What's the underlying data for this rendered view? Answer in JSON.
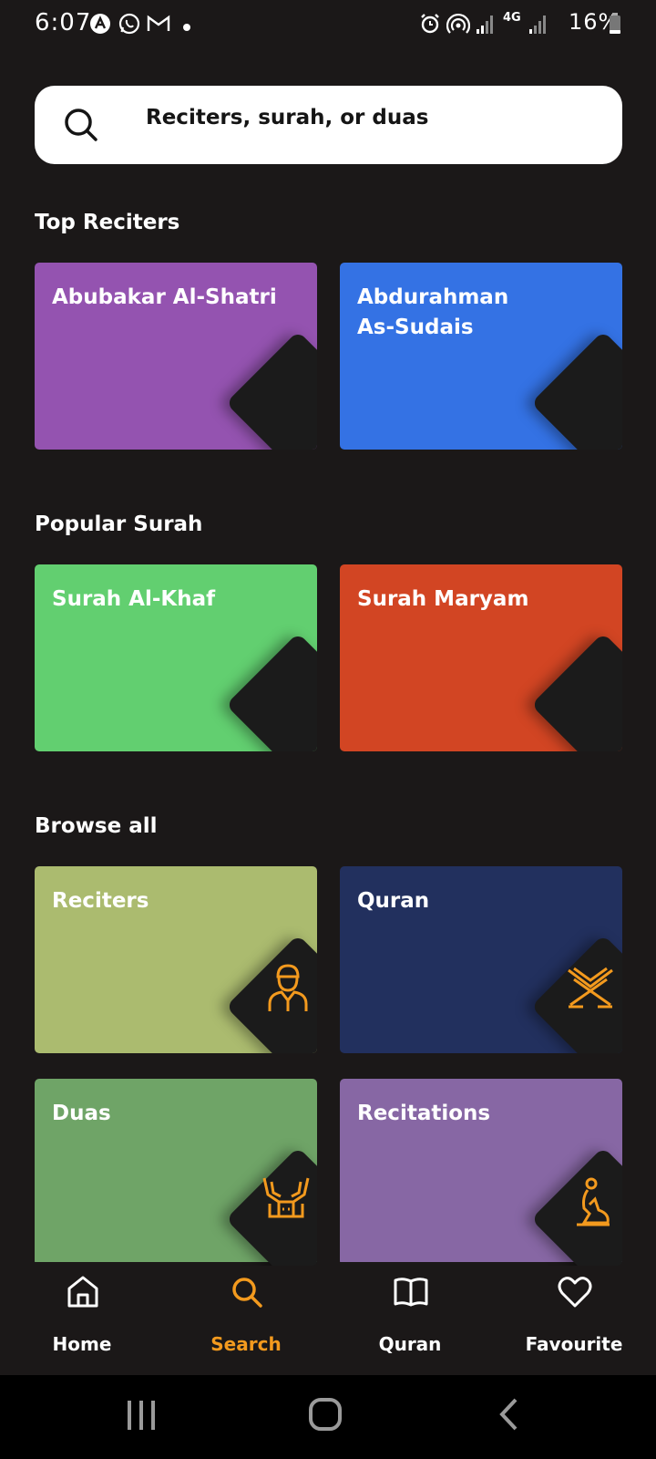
{
  "status_bar": {
    "time": "6:07",
    "battery": "16%",
    "network": "4G"
  },
  "search": {
    "placeholder": "Reciters, surah, or duas"
  },
  "sections": {
    "top_reciters": "Top Reciters",
    "popular_surah": "Popular Surah",
    "browse_all": "Browse all"
  },
  "top_reciters": [
    {
      "title": "Abubakar Al-Shatri",
      "color": "#9453b0"
    },
    {
      "title": "Abdurahman As-Sudais",
      "color": "#3472e4"
    }
  ],
  "popular_surah": [
    {
      "title": "Surah Al-Khaf",
      "color": "#62cf70"
    },
    {
      "title": "Surah Maryam",
      "color": "#d24523"
    }
  ],
  "browse_all": [
    {
      "title": "Reciters",
      "color": "#abbb6f",
      "icon": "person-icon"
    },
    {
      "title": "Quran",
      "color": "#22305e",
      "icon": "quran-stand-icon"
    },
    {
      "title": "Duas",
      "color": "#6fa467",
      "icon": "praying-hands-icon"
    },
    {
      "title": "Recitations",
      "color": "#8767a4",
      "icon": "kneeling-prayer-icon"
    }
  ],
  "bottom_nav": {
    "home": "Home",
    "search": "Search",
    "quran": "Quran",
    "favourite": "Favourite",
    "active": "Search"
  },
  "colors": {
    "accent": "#f39a1e",
    "background": "#1b1818"
  }
}
